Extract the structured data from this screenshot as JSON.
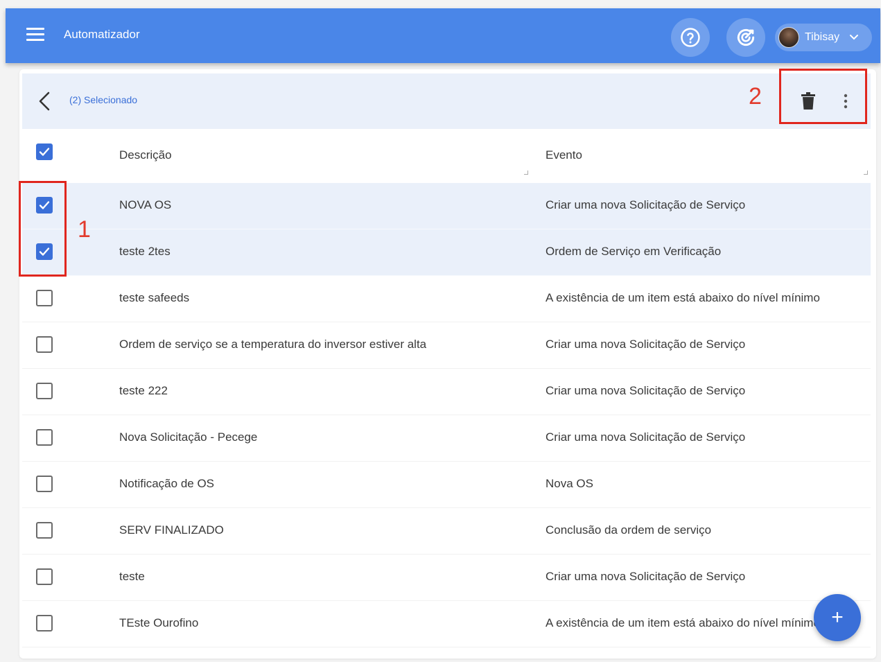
{
  "appbar": {
    "title": "Automatizador",
    "user_name": "Tibisay",
    "help_icon": "help-circle-icon",
    "sync_icon": "sync-target-icon",
    "color": "#4a86e8"
  },
  "selection_bar": {
    "label": "(2) Selecionado",
    "annotation_rows": "1",
    "annotation_actions": "2"
  },
  "table": {
    "headers": {
      "description": "Descrição",
      "event": "Evento"
    },
    "rows": [
      {
        "description": "NOVA OS",
        "event": "Criar uma nova Solicitação de Serviço",
        "checked": true
      },
      {
        "description": "teste 2tes",
        "event": "Ordem de Serviço em Verificação",
        "checked": true
      },
      {
        "description": "teste safeeds",
        "event": "A existência de um item está abaixo do nível mínimo",
        "checked": false
      },
      {
        "description": "Ordem de serviço se a temperatura do inversor estiver alta",
        "event": "Criar uma nova Solicitação de Serviço",
        "checked": false
      },
      {
        "description": "teste 222",
        "event": "Criar uma nova Solicitação de Serviço",
        "checked": false
      },
      {
        "description": "Nova Solicitação - Pecege",
        "event": "Criar uma nova Solicitação de Serviço",
        "checked": false
      },
      {
        "description": "Notificação de OS",
        "event": "Nova OS",
        "checked": false
      },
      {
        "description": "SERV FINALIZADO",
        "event": "Conclusão da ordem de serviço",
        "checked": false
      },
      {
        "description": "teste",
        "event": "Criar uma nova Solicitação de Serviço",
        "checked": false
      },
      {
        "description": "TEste Ourofino",
        "event": "A existência de um item está abaixo do nível mínimo",
        "checked": false
      }
    ]
  },
  "fab": {
    "label": "+"
  },
  "colors": {
    "accent": "#3a6fd8",
    "selection": "#eaf0fa",
    "annotation": "#e0261e"
  }
}
